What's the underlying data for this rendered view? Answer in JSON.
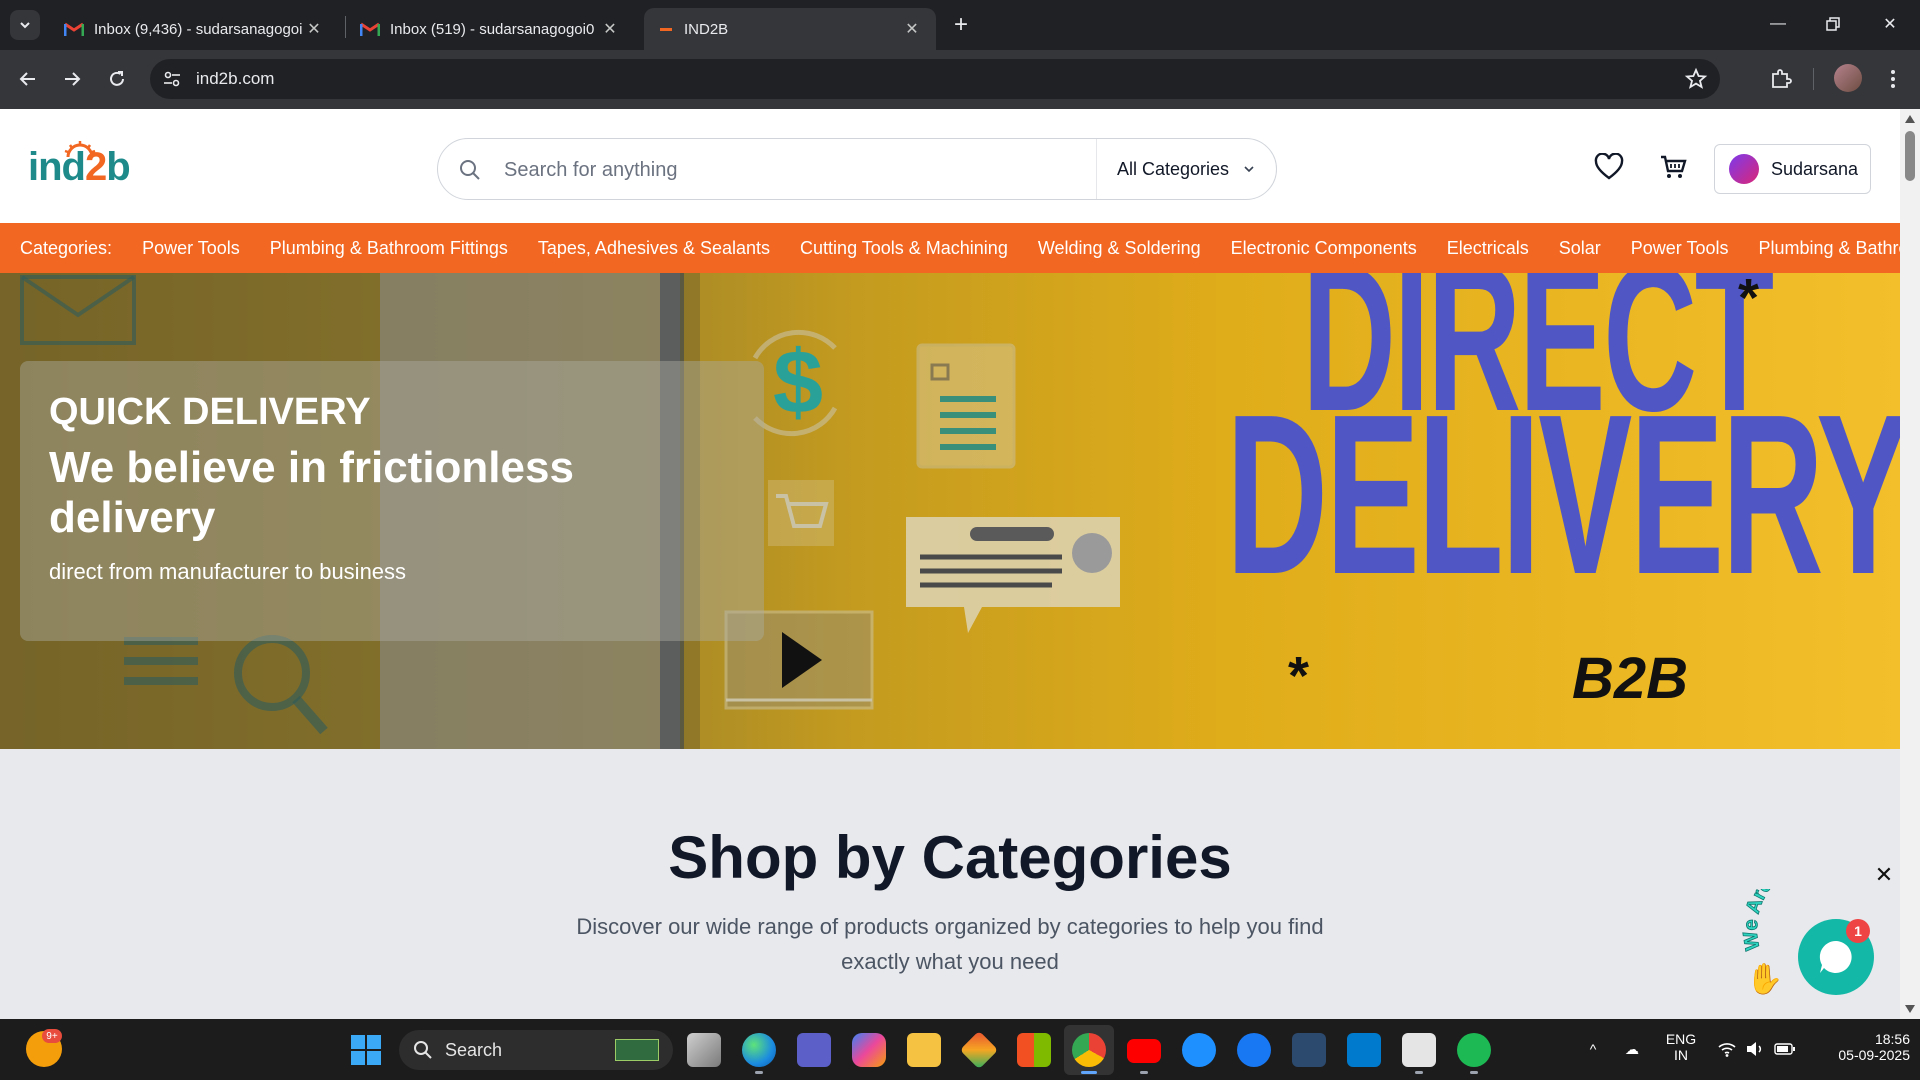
{
  "browser": {
    "tabs": [
      {
        "title": "Inbox (9,436) - sudarsanagogoi",
        "icon": "gmail-icon"
      },
      {
        "title": "Inbox (519) - sudarsanagogoi0",
        "icon": "gmail-icon"
      },
      {
        "title": "IND2B",
        "icon": "ind2b-favicon",
        "active": true
      }
    ],
    "url": "ind2b.com"
  },
  "site": {
    "logo_part1": "ind",
    "logo_part2": "2",
    "logo_part3": "b",
    "search_placeholder": "Search for anything",
    "category_select": "All Categories",
    "user_name": "Sudarsana",
    "categories_label": "Categories:",
    "categories": [
      "Power Tools",
      "Plumbing & Bathroom Fittings",
      "Tapes, Adhesives & Sealants",
      "Cutting Tools & Machining",
      "Welding & Soldering",
      "Electronic Components",
      "Electricals",
      "Solar",
      "Power Tools",
      "Plumbing & Bathroom"
    ],
    "accent_color": "#f26722",
    "brand_teal": "#1f8a8a"
  },
  "hero": {
    "kicker": "QUICK DELIVERY",
    "headline": "We believe in frictionless delivery",
    "subtext": "direct from manufacturer to business",
    "banner_word1": "DIRECT",
    "banner_word2": "DELIVERY",
    "banner_tag": "B2B"
  },
  "shop": {
    "title": "Shop by Categories",
    "description": "Discover our wide range of products organized by categories to help you find exactly what you need"
  },
  "chat_widget": {
    "banner_text": "We Are Here!",
    "badge_count": "1"
  },
  "taskbar": {
    "weather_badge": "9+",
    "search_label": "Search",
    "language_line1": "ENG",
    "language_line2": "IN",
    "time": "18:56",
    "date": "05-09-2025"
  }
}
